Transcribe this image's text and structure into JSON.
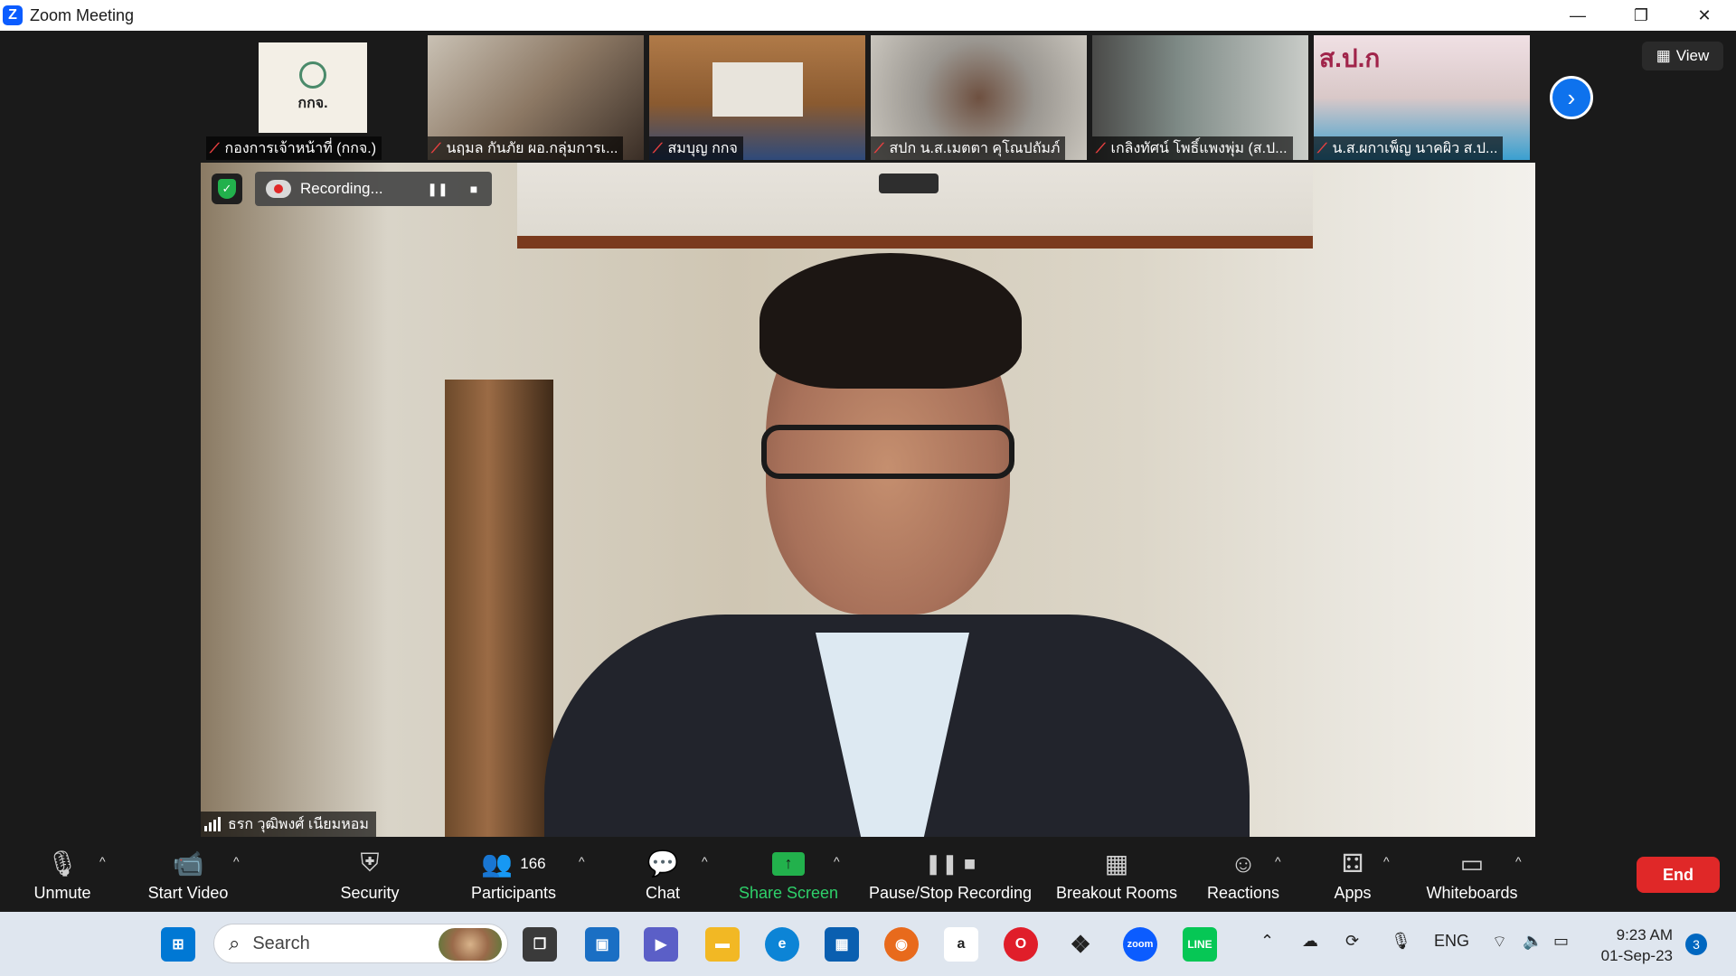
{
  "window": {
    "title": "Zoom Meeting",
    "minimize": "—",
    "restore": "❐",
    "close": "✕"
  },
  "view_button": {
    "label": "View"
  },
  "participants_strip": [
    {
      "name": "กองการเจ้าหน้าที่ (กกจ.)",
      "muted": true,
      "bg": "#f3efe6"
    },
    {
      "name": "นฤมล กันภัย ผอ.กลุ่มการเ...",
      "muted": true,
      "bg": "#8c7864"
    },
    {
      "name": "สมบุญ กกจ",
      "muted": true,
      "bg": "#8a5a30"
    },
    {
      "name": "สปก น.ส.เมตตา คุโณปถัมภ์",
      "muted": true,
      "bg": "#9a9690"
    },
    {
      "name": "เกลิงทัศน์ โพธิ์แพงพุ่ม (ส.ป...",
      "muted": true,
      "bg": "#7e8a86"
    },
    {
      "name": "น.ส.ผกาเพ็ญ นาคผิว ส.ป...",
      "muted": true,
      "bg": "#d9c8c8"
    }
  ],
  "strip_logo_text": "กกจ.",
  "strip_banner_text": "ส.ป.ก",
  "recording": {
    "label": "Recording...",
    "pause_icon": "❚❚",
    "stop_icon": "■"
  },
  "speaker": {
    "name": "ธรก วุฒิพงศ์ เนียมหอม"
  },
  "toolbar": {
    "unmute": "Unmute",
    "start_video": "Start Video",
    "security": "Security",
    "participants": "Participants",
    "participants_count": "166",
    "chat": "Chat",
    "share_screen": "Share Screen",
    "pause_stop_recording": "Pause/Stop Recording",
    "breakout_rooms": "Breakout Rooms",
    "reactions": "Reactions",
    "apps": "Apps",
    "whiteboards": "Whiteboards",
    "end": "End",
    "caret": "^"
  },
  "taskbar": {
    "search_placeholder": "Search",
    "language": "ENG",
    "time": "9:23 AM",
    "date": "01-Sep-23",
    "notification_count": "3"
  }
}
